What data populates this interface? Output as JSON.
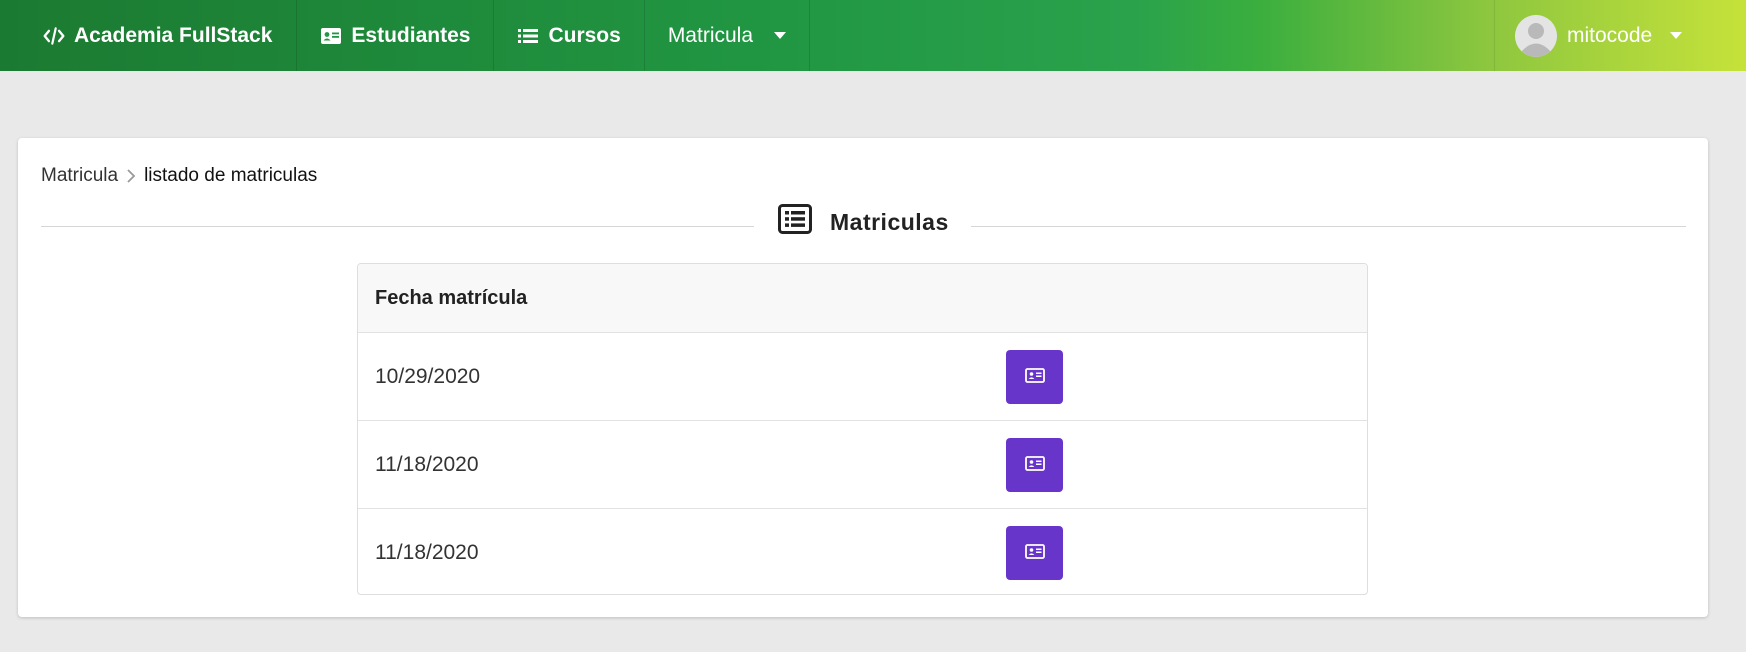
{
  "navbar": {
    "brand": "Academia FullStack",
    "items": [
      {
        "label": "Estudiantes",
        "icon": "id-card-icon"
      },
      {
        "label": "Cursos",
        "icon": "list-icon"
      },
      {
        "label": "Matricula",
        "icon": "chevron-down-icon"
      }
    ],
    "user": {
      "name": "mitocode",
      "icon": "user-avatar-icon"
    }
  },
  "breadcrumb": {
    "items": [
      "Matricula",
      "listado de matriculas"
    ]
  },
  "section": {
    "title": "Matriculas",
    "icon": "list-alt-icon"
  },
  "table": {
    "header": "Fecha matrícula",
    "rows": [
      {
        "date": "10/29/2020",
        "action_icon": "id-card-icon"
      },
      {
        "date": "11/18/2020",
        "action_icon": "id-card-icon"
      },
      {
        "date": "11/18/2020",
        "action_icon": "id-card-icon"
      }
    ]
  },
  "colors": {
    "nav_start": "#1b7a31",
    "nav_end": "#c6e23a",
    "action_button": "#6735c9",
    "background": "#e9e9e9"
  }
}
